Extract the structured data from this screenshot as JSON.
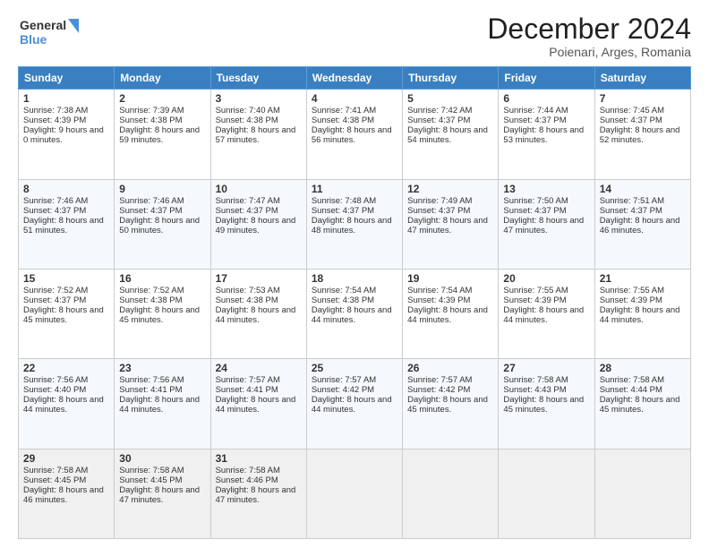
{
  "header": {
    "logo_line1": "General",
    "logo_line2": "Blue",
    "month_title": "December 2024",
    "location": "Poienari, Arges, Romania"
  },
  "days_of_week": [
    "Sunday",
    "Monday",
    "Tuesday",
    "Wednesday",
    "Thursday",
    "Friday",
    "Saturday"
  ],
  "weeks": [
    [
      {
        "day": "1",
        "info": "Sunrise: 7:38 AM\nSunset: 4:39 PM\nDaylight: 9 hours and 0 minutes."
      },
      {
        "day": "2",
        "info": "Sunrise: 7:39 AM\nSunset: 4:38 PM\nDaylight: 8 hours and 59 minutes."
      },
      {
        "day": "3",
        "info": "Sunrise: 7:40 AM\nSunset: 4:38 PM\nDaylight: 8 hours and 57 minutes."
      },
      {
        "day": "4",
        "info": "Sunrise: 7:41 AM\nSunset: 4:38 PM\nDaylight: 8 hours and 56 minutes."
      },
      {
        "day": "5",
        "info": "Sunrise: 7:42 AM\nSunset: 4:37 PM\nDaylight: 8 hours and 54 minutes."
      },
      {
        "day": "6",
        "info": "Sunrise: 7:44 AM\nSunset: 4:37 PM\nDaylight: 8 hours and 53 minutes."
      },
      {
        "day": "7",
        "info": "Sunrise: 7:45 AM\nSunset: 4:37 PM\nDaylight: 8 hours and 52 minutes."
      }
    ],
    [
      {
        "day": "8",
        "info": "Sunrise: 7:46 AM\nSunset: 4:37 PM\nDaylight: 8 hours and 51 minutes."
      },
      {
        "day": "9",
        "info": "Sunrise: 7:46 AM\nSunset: 4:37 PM\nDaylight: 8 hours and 50 minutes."
      },
      {
        "day": "10",
        "info": "Sunrise: 7:47 AM\nSunset: 4:37 PM\nDaylight: 8 hours and 49 minutes."
      },
      {
        "day": "11",
        "info": "Sunrise: 7:48 AM\nSunset: 4:37 PM\nDaylight: 8 hours and 48 minutes."
      },
      {
        "day": "12",
        "info": "Sunrise: 7:49 AM\nSunset: 4:37 PM\nDaylight: 8 hours and 47 minutes."
      },
      {
        "day": "13",
        "info": "Sunrise: 7:50 AM\nSunset: 4:37 PM\nDaylight: 8 hours and 47 minutes."
      },
      {
        "day": "14",
        "info": "Sunrise: 7:51 AM\nSunset: 4:37 PM\nDaylight: 8 hours and 46 minutes."
      }
    ],
    [
      {
        "day": "15",
        "info": "Sunrise: 7:52 AM\nSunset: 4:37 PM\nDaylight: 8 hours and 45 minutes."
      },
      {
        "day": "16",
        "info": "Sunrise: 7:52 AM\nSunset: 4:38 PM\nDaylight: 8 hours and 45 minutes."
      },
      {
        "day": "17",
        "info": "Sunrise: 7:53 AM\nSunset: 4:38 PM\nDaylight: 8 hours and 44 minutes."
      },
      {
        "day": "18",
        "info": "Sunrise: 7:54 AM\nSunset: 4:38 PM\nDaylight: 8 hours and 44 minutes."
      },
      {
        "day": "19",
        "info": "Sunrise: 7:54 AM\nSunset: 4:39 PM\nDaylight: 8 hours and 44 minutes."
      },
      {
        "day": "20",
        "info": "Sunrise: 7:55 AM\nSunset: 4:39 PM\nDaylight: 8 hours and 44 minutes."
      },
      {
        "day": "21",
        "info": "Sunrise: 7:55 AM\nSunset: 4:39 PM\nDaylight: 8 hours and 44 minutes."
      }
    ],
    [
      {
        "day": "22",
        "info": "Sunrise: 7:56 AM\nSunset: 4:40 PM\nDaylight: 8 hours and 44 minutes."
      },
      {
        "day": "23",
        "info": "Sunrise: 7:56 AM\nSunset: 4:41 PM\nDaylight: 8 hours and 44 minutes."
      },
      {
        "day": "24",
        "info": "Sunrise: 7:57 AM\nSunset: 4:41 PM\nDaylight: 8 hours and 44 minutes."
      },
      {
        "day": "25",
        "info": "Sunrise: 7:57 AM\nSunset: 4:42 PM\nDaylight: 8 hours and 44 minutes."
      },
      {
        "day": "26",
        "info": "Sunrise: 7:57 AM\nSunset: 4:42 PM\nDaylight: 8 hours and 45 minutes."
      },
      {
        "day": "27",
        "info": "Sunrise: 7:58 AM\nSunset: 4:43 PM\nDaylight: 8 hours and 45 minutes."
      },
      {
        "day": "28",
        "info": "Sunrise: 7:58 AM\nSunset: 4:44 PM\nDaylight: 8 hours and 45 minutes."
      }
    ],
    [
      {
        "day": "29",
        "info": "Sunrise: 7:58 AM\nSunset: 4:45 PM\nDaylight: 8 hours and 46 minutes."
      },
      {
        "day": "30",
        "info": "Sunrise: 7:58 AM\nSunset: 4:45 PM\nDaylight: 8 hours and 47 minutes."
      },
      {
        "day": "31",
        "info": "Sunrise: 7:58 AM\nSunset: 4:46 PM\nDaylight: 8 hours and 47 minutes."
      },
      {
        "day": "",
        "info": ""
      },
      {
        "day": "",
        "info": ""
      },
      {
        "day": "",
        "info": ""
      },
      {
        "day": "",
        "info": ""
      }
    ]
  ]
}
